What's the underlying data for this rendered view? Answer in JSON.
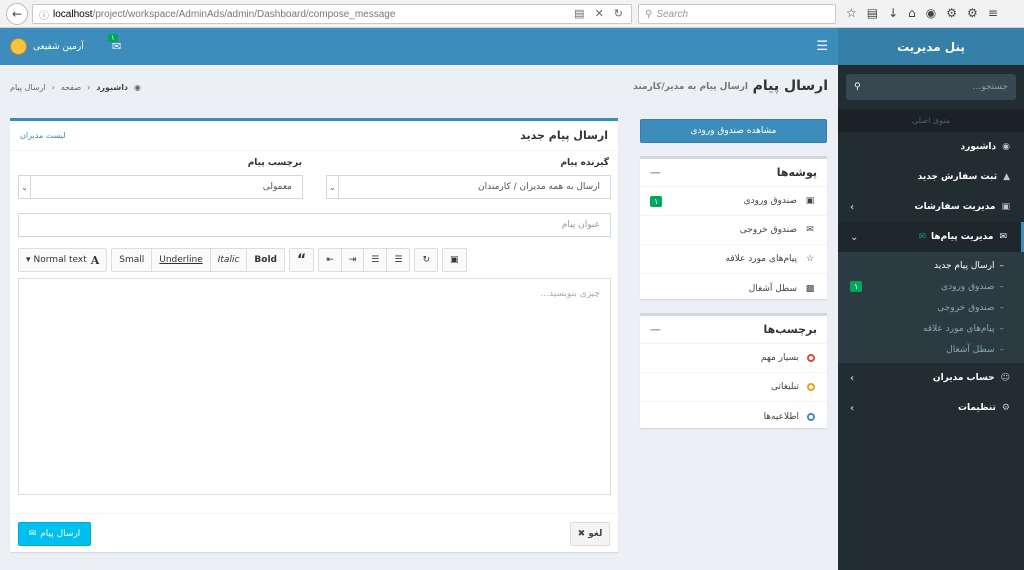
{
  "browser": {
    "url_host": "localhost",
    "url_path": "/project/workspace/AdminAds/admin/Dashboard/compose_message",
    "search_placeholder": "Search"
  },
  "sidebar": {
    "logo": "پنل مدیریت",
    "search_placeholder": "جستجو...",
    "section_header": "منوی اصلی",
    "items": [
      {
        "label": "داشبورد",
        "icon": "dashboard-icon"
      },
      {
        "label": "ثبت سفارش جدید",
        "icon": "cart-icon"
      },
      {
        "label": "مدیریت سفارشات",
        "icon": "cubes-icon"
      },
      {
        "label": "مدیریت پیام‌ها",
        "icon": "envelope-icon"
      },
      {
        "label": "حساب مدیران",
        "icon": "user-icon"
      },
      {
        "label": "تنظیمات",
        "icon": "gears-icon"
      }
    ],
    "sub_items": [
      {
        "label": "ارسال پیام جدید"
      },
      {
        "label": "صندوق ورودی",
        "badge": "۱"
      },
      {
        "label": "صندوق خروجی"
      },
      {
        "label": "پیام‌های مورد علاقه"
      },
      {
        "label": "سطل آشغال"
      }
    ]
  },
  "topbar": {
    "user_name": "آرمین شفیعی",
    "mail_badge": "۱"
  },
  "header": {
    "title": "ارسال پیام",
    "subtitle": "ارسال پیام به مدیر/کارمند",
    "breadcrumb": [
      "داشبورد",
      "صفحه",
      "ارسال پیام"
    ]
  },
  "compose": {
    "title": "ارسال پیام جدید",
    "list_link": "لیست مدیران",
    "recipient_label": "گیرنده پیام",
    "recipient_value": "ارسال به همه مدیران / کارمندان",
    "tag_label": "برچسب پیام",
    "tag_value": "معمولی",
    "subject_placeholder": "عنوان پیام",
    "body_placeholder": "چیزی بنویسید...",
    "toolbar": {
      "normal_text": "Normal text",
      "bold": "Bold",
      "italic": "Italic",
      "underline": "Underline",
      "small": "Small"
    },
    "send_label": "ارسال پیام",
    "cancel_label": "لغو"
  },
  "right_col": {
    "inbox_button": "مشاهده صندوق ورودی",
    "folders_title": "پوشه‌ها",
    "folders": [
      {
        "label": "صندوق ورودی",
        "badge": "۱",
        "icon": "inbox-icon"
      },
      {
        "label": "صندوق خروجی",
        "icon": "envelope-outline-icon"
      },
      {
        "label": "پیام‌های مورد علاقه",
        "icon": "star-icon"
      },
      {
        "label": "سطل آشغال",
        "icon": "trash-icon"
      }
    ],
    "labels_title": "برچسب‌ها",
    "labels": [
      {
        "label": "بسیار مهم",
        "color": "#dd4b39"
      },
      {
        "label": "تبلیغاتی",
        "color": "#f39c12"
      },
      {
        "label": "اطلاعیه‌ها",
        "color": "#3c8dbc"
      }
    ]
  }
}
